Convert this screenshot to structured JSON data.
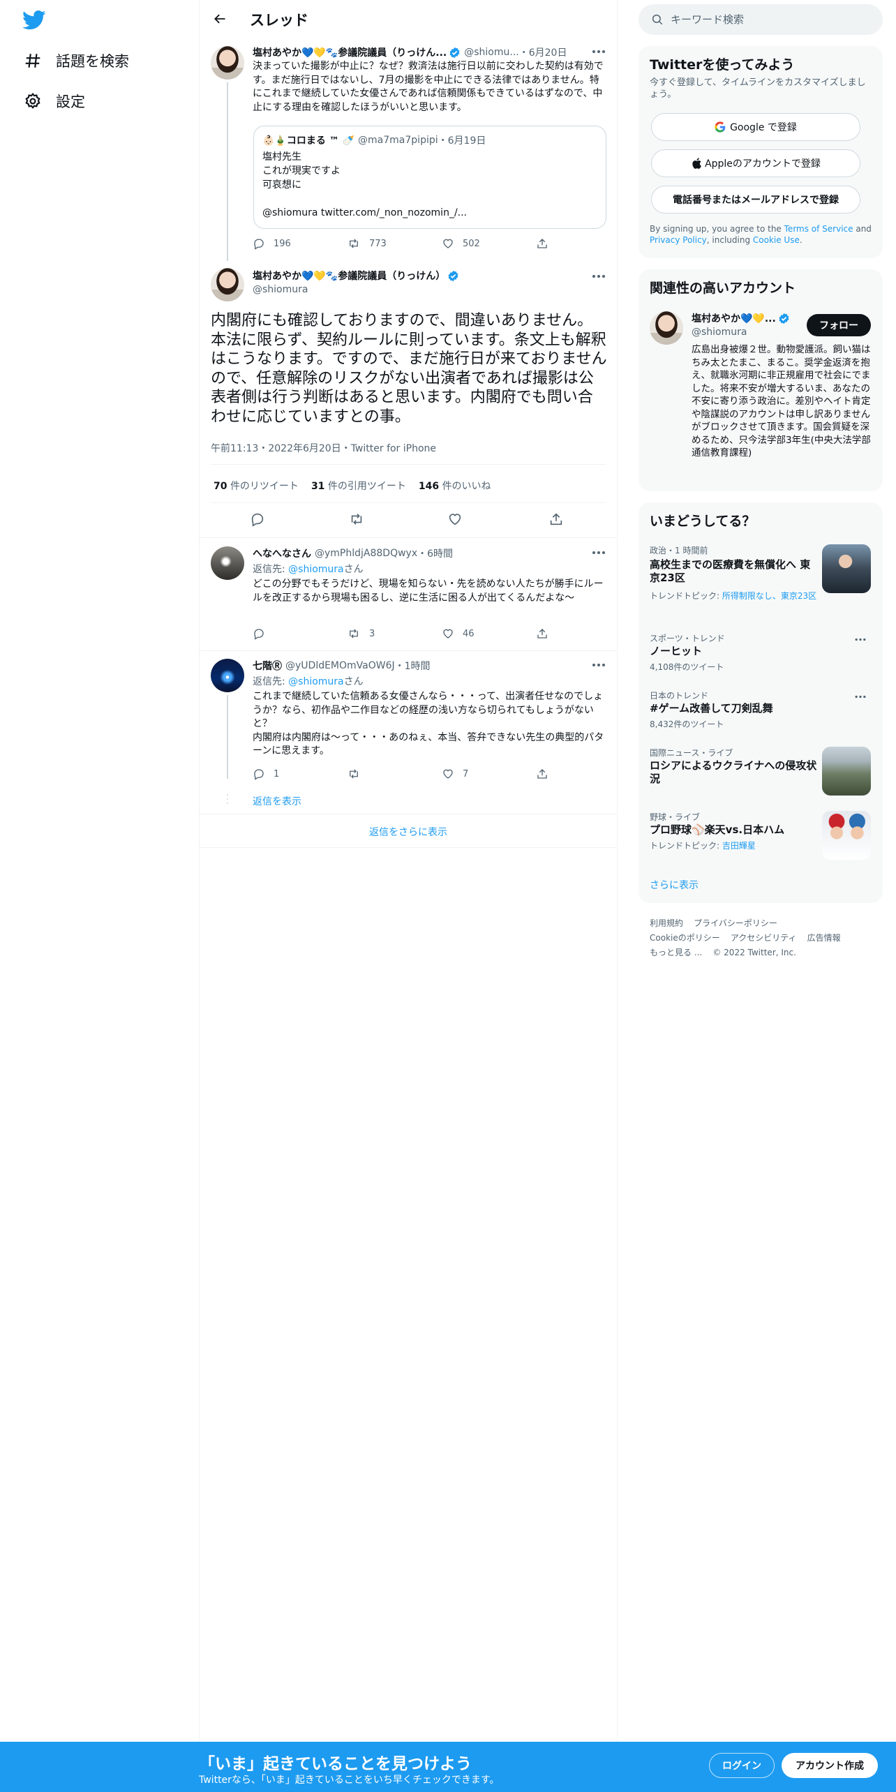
{
  "nav": {
    "explore_label": "話題を検索",
    "settings_label": "設定"
  },
  "header": {
    "title": "スレッド"
  },
  "tweet1": {
    "name": "塩村あやか💙💛🐾参議院議員（りっけん...",
    "handle": "@shiomu...",
    "date": "・6月20日",
    "text": "決まっていた撮影が中止に？なぜ？救済法は施行日以前に交わした契約は有効です。まだ施行日ではないし、7月の撮影を中止にできる法律ではありません。特にこれまで継続していた女優さんであれば信頼関係もできているはずなので、中止にする理由を確認したほうがいいと思います。",
    "quote": {
      "name": "👶🏻🎍コロまる ™ 🍼",
      "handle": "@ma7ma7pipipi",
      "date": "・6月19日",
      "line1": "塩村先生",
      "line2": "これが現実ですよ",
      "line3": "可哀想に",
      "line4": "@shiomura twitter.com/_non_nozomin_/..."
    },
    "replies": "196",
    "retweets": "773",
    "likes": "502"
  },
  "main_tweet": {
    "name": "塩村あやか💙💛🐾参議院議員（りっけん）",
    "handle": "@shiomura",
    "text": "内閣府にも確認しておりますので、間違いありません。本法に限らず、契約ルールに則っています。条文上も解釈はこうなります。ですので、まだ施行日が来ておりませんので、任意解除のリスクがない出演者であれば撮影は公表者側は行う判断はあると思います。内閣府でも問い合わせに応じていますとの事。",
    "meta": "午前11:13・2022年6月20日・Twitter for iPhone",
    "retweet_count": "70",
    "retweet_label": "件のリツイート",
    "quote_count": "31",
    "quote_label": "件の引用ツイート",
    "like_count": "146",
    "like_label": "件のいいね"
  },
  "reply1": {
    "name": "へなへなさん",
    "handle": "@ymPhldjA88DQwyx",
    "date": "・6時間",
    "reply_to_prefix": "返信先: ",
    "reply_to_handle": "@shiomura",
    "reply_to_suffix": "さん",
    "text": "どこの分野でもそうだけど、現場を知らない・先を読めない人たちが勝手にルールを改正するから現場も困るし、逆に生活に困る人が出てくるんだよな〜",
    "replies": "",
    "retweets": "3",
    "likes": "46"
  },
  "reply2": {
    "name": "七階Ⓡ",
    "handle": "@yUDldEMOmVaOW6J",
    "date": "・1時間",
    "reply_to_prefix": "返信先: ",
    "reply_to_handle": "@shiomura",
    "reply_to_suffix": "さん",
    "text": "これまで継続していた信頼ある女優さんなら・・・って、出演者任せなのでしょうか？なら、初作品や二作目などの経歴の浅い方なら切られてもしょうがないと？\n内閣府は内閣府は〜って・・・あのねぇ、本当、答弁できない先生の典型的パターンに思えます。",
    "replies": "1",
    "retweets": "",
    "likes": "7",
    "show_replies": "返信を表示"
  },
  "show_more_replies": "返信をさらに表示",
  "search": {
    "placeholder": "キーワード検索"
  },
  "signup_card": {
    "title": "Twitterを使ってみよう",
    "subtitle": "今すぐ登録して、タイムラインをカスタマイズしましょう。",
    "google": "Google で登録",
    "apple": "Appleのアカウントで登録",
    "phone": "電話番号またはメールアドレスで登録",
    "legal_prefix": "By signing up, you agree to the ",
    "tos": "Terms of Service",
    "and": " and ",
    "privacy": "Privacy Policy",
    "including": ", including ",
    "cookie": "Cookie Use",
    "period": "."
  },
  "relevant": {
    "title": "関連性の高いアカウント",
    "name": "塩村あやか💙💛...",
    "handle": "@shiomura",
    "follow": "フォロー",
    "bio": "広島出身被爆２世。動物愛護派。飼い猫はちみ太とたまこ、まるこ。奨学金返済を抱え、就職氷河期に非正規雇用で社会にでました。将来不安が増大するいま、あなたの不安に寄り添う政治に。差別やヘイト肯定や陰謀説のアカウントは申し訳ありませんがブロックさせて頂きます。国会質疑を深めるため、只今法学部3年生(中央大法学部通信教育課程)"
  },
  "trends": {
    "title": "いまどうしてる？",
    "items": [
      {
        "category": "政治・1 時間前",
        "title": "高校生までの医療費を無償化へ 東京23区",
        "sub_prefix": "トレンドトピック: ",
        "sub_links": "所得制限なし、東京23区"
      },
      {
        "category": "スポーツ・トレンド",
        "title": "ノーヒット",
        "sub": "4,108件のツイート"
      },
      {
        "category": "日本のトレンド",
        "title": "#ゲーム改善して刀剣乱舞",
        "sub": "8,432件のツイート"
      },
      {
        "category": "国際ニュース・ライブ",
        "title": "ロシアによるウクライナへの侵攻状況"
      },
      {
        "category": "野球・ライブ",
        "title": "プロ野球⚾楽天vs.日本ハム",
        "sub_prefix": "トレンドトピック: ",
        "sub_links": "吉田輝星"
      }
    ],
    "show_more": "さらに表示"
  },
  "footer": {
    "terms": "利用規約",
    "privacy": "プライバシーポリシー",
    "cookie": "Cookieのポリシー",
    "accessibility": "アクセシビリティ",
    "ads": "広告情報",
    "more": "もっと見る ...",
    "copyright": "© 2022 Twitter, Inc."
  },
  "banner": {
    "title": "「いま」起きていることを見つけよう",
    "subtitle": "Twitterなら、「いま」起きていることをいち早くチェックできます。",
    "login": "ログイン",
    "signup": "アカウント作成"
  },
  "colors": {
    "brand": "#1d9bf0",
    "text": "#0f1419",
    "muted": "#536471",
    "border": "#eff3f4"
  }
}
